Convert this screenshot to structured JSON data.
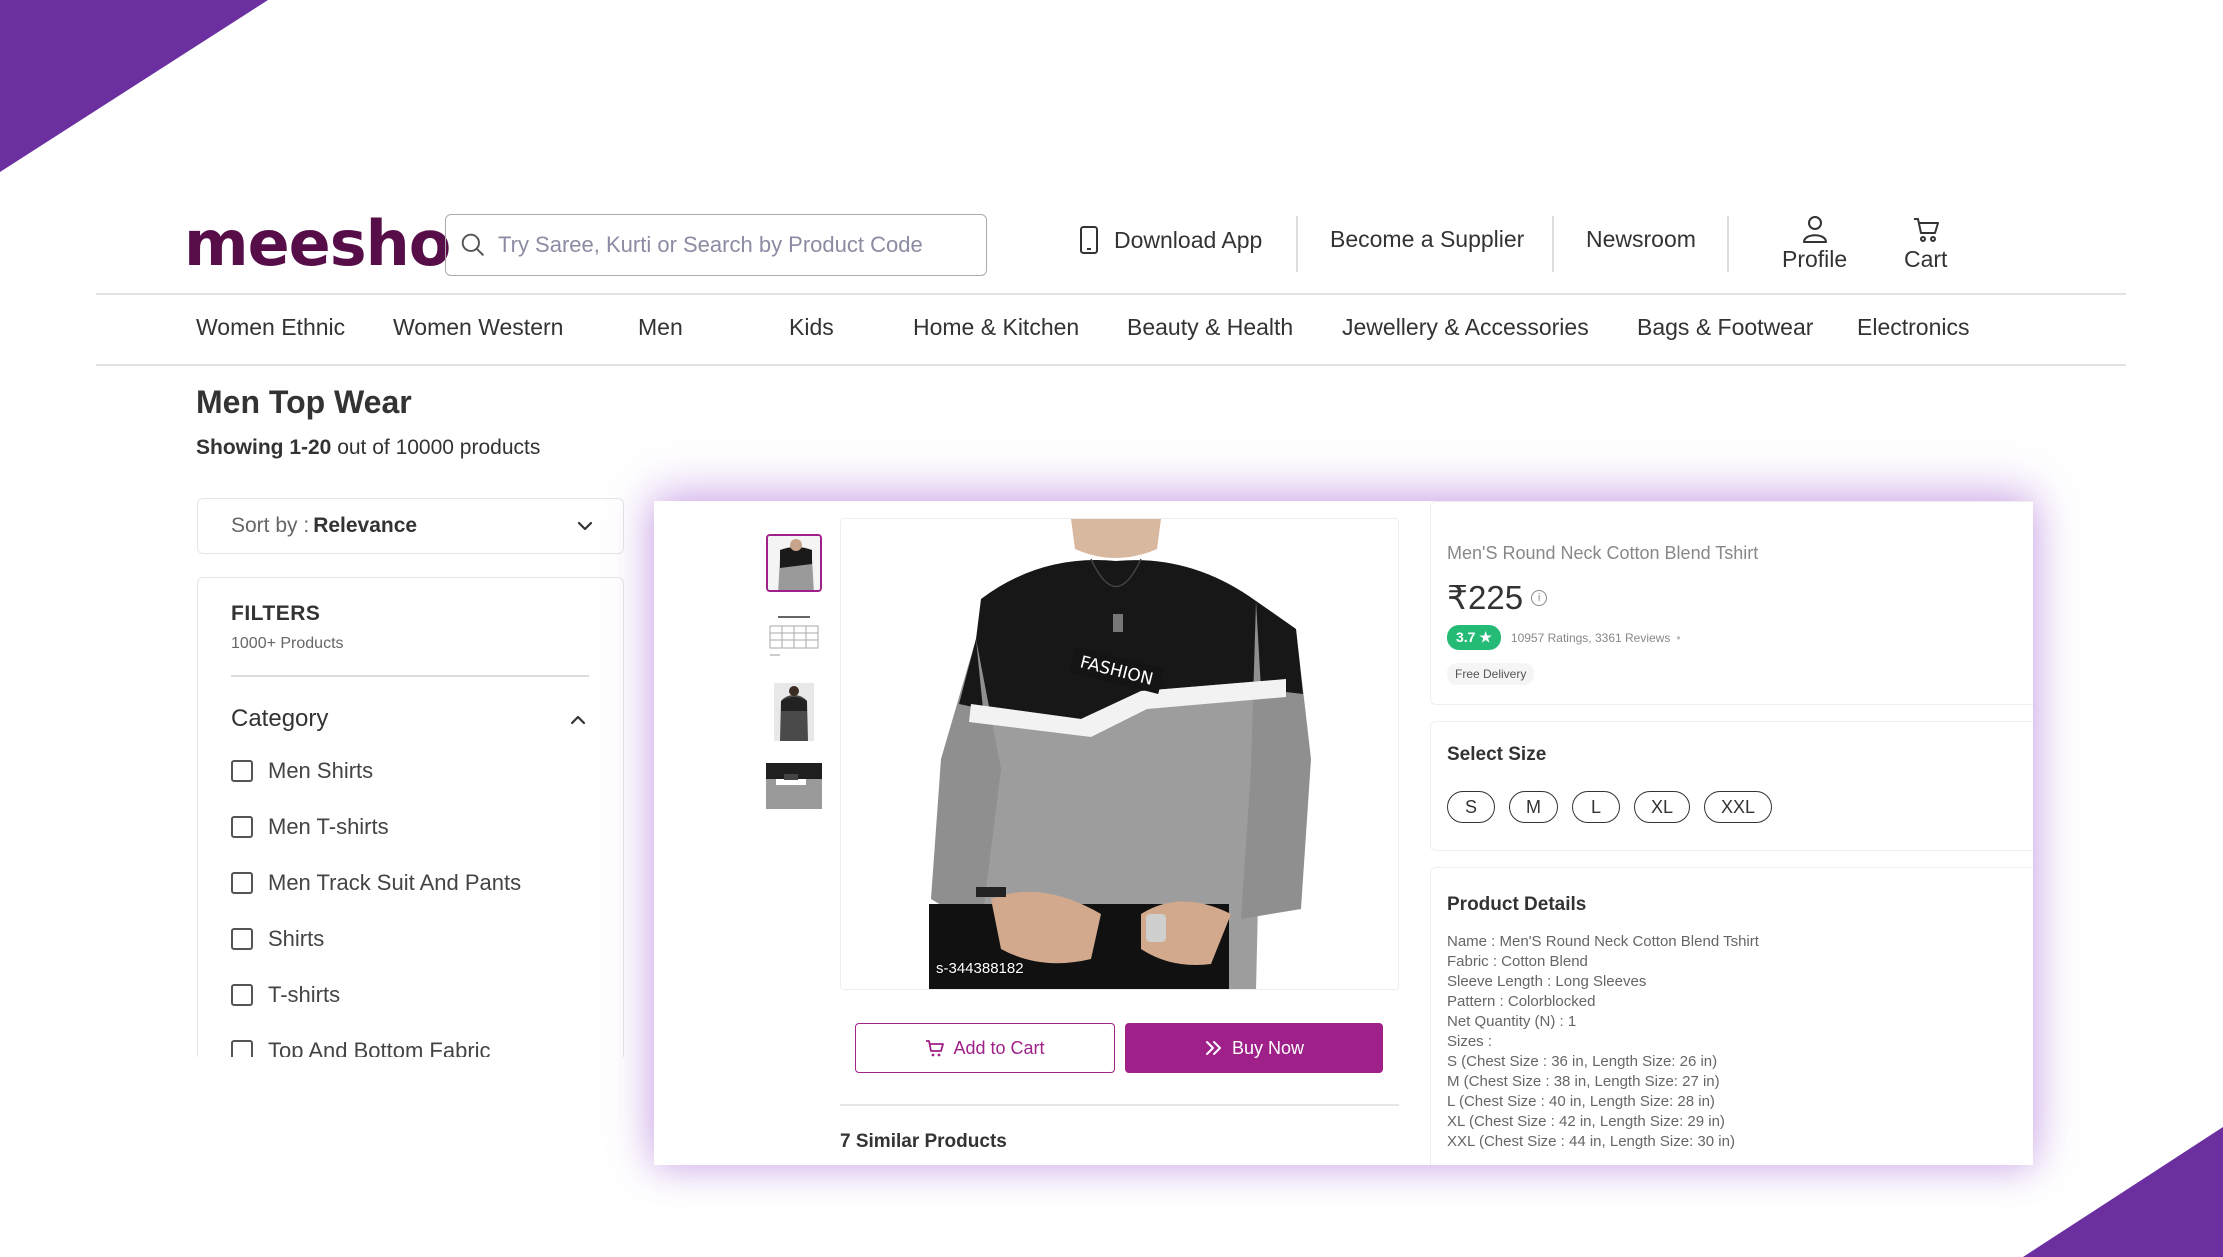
{
  "brand": {
    "logo": "meesho",
    "color": "#570d48",
    "accent": "#9f2089",
    "decor": "#6b2fa0"
  },
  "search": {
    "placeholder": "Try Saree, Kurti or Search by Product Code",
    "icon": "search-icon"
  },
  "header": {
    "download_app": "Download App",
    "become_supplier": "Become a Supplier",
    "newsroom": "Newsroom",
    "profile": "Profile",
    "cart": "Cart"
  },
  "categories": [
    "Women Ethnic",
    "Women Western",
    "Men",
    "Kids",
    "Home & Kitchen",
    "Beauty & Health",
    "Jewellery & Accessories",
    "Bags & Footwear",
    "Electronics"
  ],
  "listing": {
    "title": "Men Top Wear",
    "showing_prefix": "Showing 1-20",
    "showing_suffix": " out of 10000 products"
  },
  "sort": {
    "label": "Sort by :",
    "value": "Relevance"
  },
  "filters": {
    "title": "FILTERS",
    "subtitle": "1000+ Products",
    "category_label": "Category",
    "items": [
      "Men Shirts",
      "Men T-shirts",
      "Men Track Suit And Pants",
      "Shirts",
      "T-shirts",
      "Top And Bottom Fabric"
    ]
  },
  "product": {
    "name": "Men'S Round Neck Cotton Blend Tshirt",
    "price": "₹225",
    "rating": "3.7 ★",
    "ratings_text": "10957 Ratings, 3361 Reviews",
    "delivery": "Free Delivery",
    "image_code": "s-344388182",
    "print_text": "FASHION",
    "add_to_cart": "Add to Cart",
    "buy_now": "Buy Now",
    "similar": "7 Similar Products",
    "select_size": "Select Size",
    "sizes": [
      "S",
      "M",
      "L",
      "XL",
      "XXL"
    ],
    "details_title": "Product Details",
    "details": [
      "Name : Men'S Round Neck Cotton Blend Tshirt",
      "Fabric : Cotton Blend",
      "Sleeve Length : Long Sleeves",
      "Pattern : Colorblocked",
      "Net Quantity (N) : 1",
      "Sizes :",
      "S (Chest Size : 36 in, Length Size: 26 in)",
      "M (Chest Size : 38 in, Length Size: 27 in)",
      "L (Chest Size : 40 in, Length Size: 28 in)",
      "XL (Chest Size : 42 in, Length Size: 29 in)",
      "XXL (Chest Size : 44 in, Length Size: 30 in)"
    ]
  }
}
